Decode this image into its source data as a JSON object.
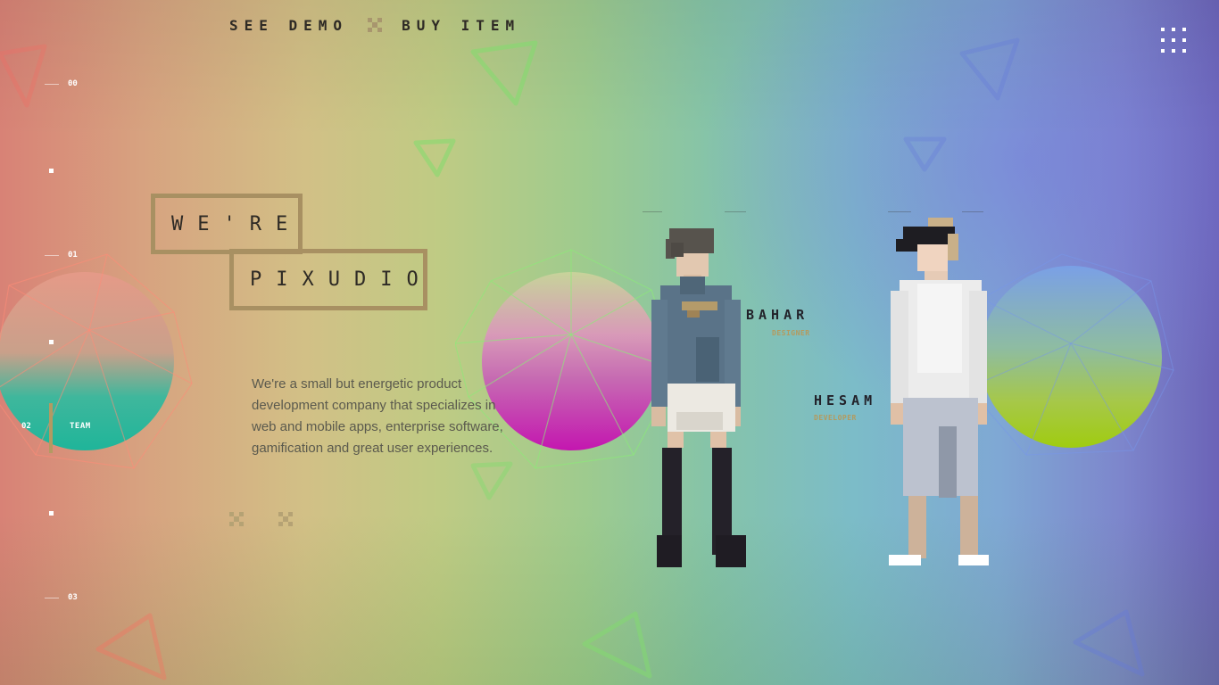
{
  "top_nav": {
    "see_demo": "SEE DEMO",
    "buy_item": "BUY ITEM"
  },
  "side_nav": {
    "items": [
      {
        "num": "00"
      },
      {
        "num": "01"
      },
      {
        "num": "02",
        "label": "TEAM",
        "active": true
      },
      {
        "num": "03"
      }
    ]
  },
  "hero": {
    "line1": "WE'RE",
    "line2": "PIXUDIO",
    "description": "We're a small but energetic product development company that specializes in web and mobile apps, enterprise software, gamification and great user experiences."
  },
  "team": [
    {
      "name": "BAHAR",
      "role": "DESIGNER"
    },
    {
      "name": "HESAM",
      "role": "DEVELOPER"
    }
  ],
  "colors": {
    "accent": "#a89062",
    "text_dark": "#2e2a25",
    "role_gold": "#b49a5e"
  },
  "icons": [
    "menu-grid-icon",
    "cross-pixel-icon",
    "wireframe-planet",
    "triangle-outline"
  ]
}
